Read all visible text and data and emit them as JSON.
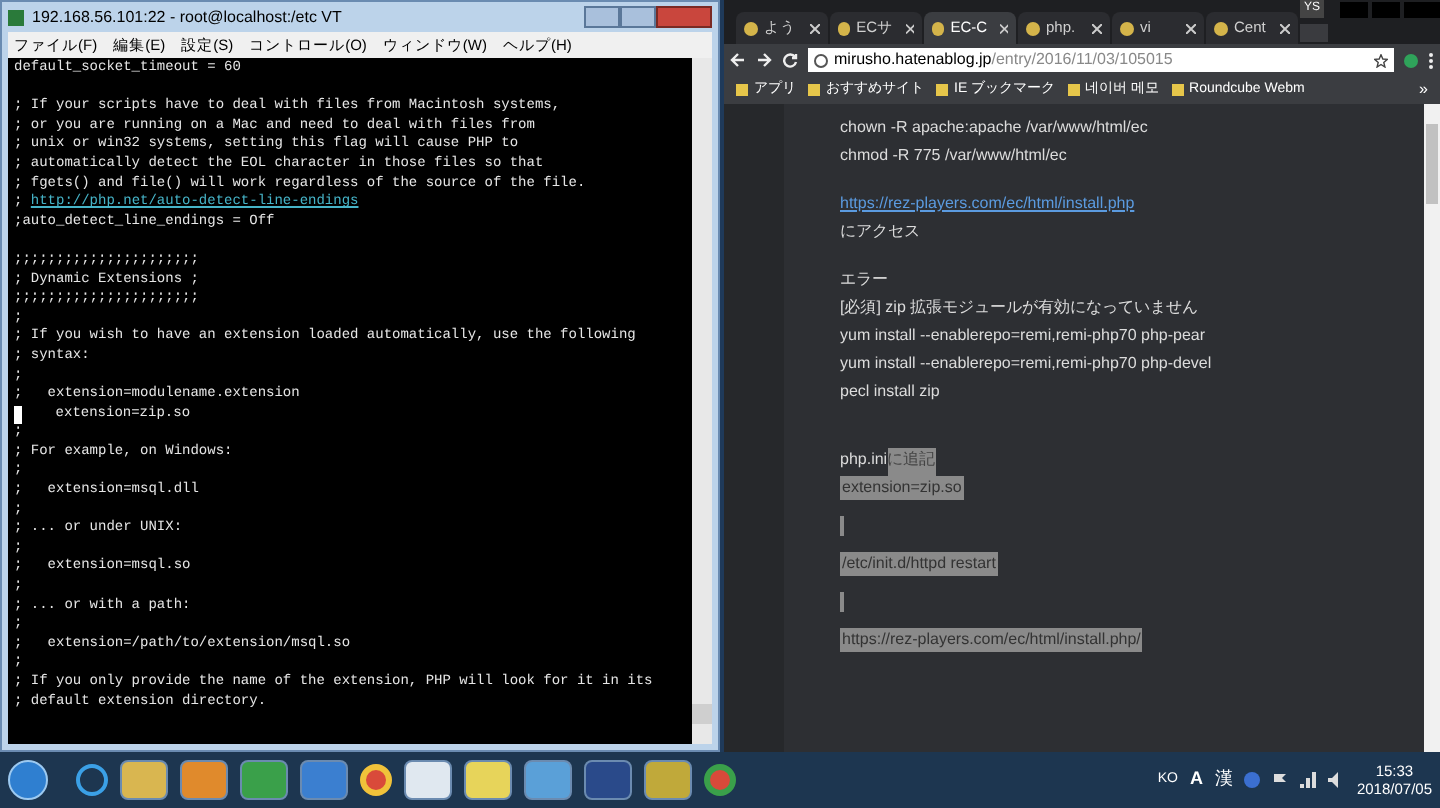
{
  "terminal": {
    "title": "192.168.56.101:22 - root@localhost:/etc VT",
    "menu": [
      "ファイル(F)",
      "編集(E)",
      "設定(S)",
      "コントロール(O)",
      "ウィンドウ(W)",
      "ヘルプ(H)"
    ],
    "lines": [
      {
        "kind": "text",
        "text": "default_socket_timeout = 60"
      },
      {
        "kind": "blank"
      },
      {
        "kind": "text",
        "text": "; If your scripts have to deal with files from Macintosh systems,"
      },
      {
        "kind": "text",
        "text": "; or you are running on a Mac and need to deal with files from"
      },
      {
        "kind": "text",
        "text": "; unix or win32 systems, setting this flag will cause PHP to"
      },
      {
        "kind": "text",
        "text": "; automatically detect the EOL character in those files so that"
      },
      {
        "kind": "text",
        "text": "; fgets() and file() will work regardless of the source of the file."
      },
      {
        "kind": "link",
        "prefix": "; ",
        "text": "http://php.net/auto-detect-line-endings"
      },
      {
        "kind": "text",
        "text": ";auto_detect_line_endings = Off"
      },
      {
        "kind": "blank"
      },
      {
        "kind": "text",
        "text": ";;;;;;;;;;;;;;;;;;;;;;"
      },
      {
        "kind": "text",
        "text": "; Dynamic Extensions ;"
      },
      {
        "kind": "text",
        "text": ";;;;;;;;;;;;;;;;;;;;;;"
      },
      {
        "kind": "text",
        "text": ";"
      },
      {
        "kind": "text",
        "text": "; If you wish to have an extension loaded automatically, use the following"
      },
      {
        "kind": "text",
        "text": "; syntax:"
      },
      {
        "kind": "text",
        "text": ";"
      },
      {
        "kind": "text",
        "text": ";   extension=modulename.extension"
      },
      {
        "kind": "cursor",
        "text": "    extension=zip.so"
      },
      {
        "kind": "text",
        "text": ";"
      },
      {
        "kind": "text",
        "text": "; For example, on Windows:"
      },
      {
        "kind": "text",
        "text": ";"
      },
      {
        "kind": "text",
        "text": ";   extension=msql.dll"
      },
      {
        "kind": "text",
        "text": ";"
      },
      {
        "kind": "text",
        "text": "; ... or under UNIX:"
      },
      {
        "kind": "text",
        "text": ";"
      },
      {
        "kind": "text",
        "text": ";   extension=msql.so"
      },
      {
        "kind": "text",
        "text": ";"
      },
      {
        "kind": "text",
        "text": "; ... or with a path:"
      },
      {
        "kind": "text",
        "text": ";"
      },
      {
        "kind": "text",
        "text": ";   extension=/path/to/extension/msql.so"
      },
      {
        "kind": "text",
        "text": ";"
      },
      {
        "kind": "text",
        "text": "; If you only provide the name of the extension, PHP will look for it in its"
      },
      {
        "kind": "text",
        "text": "; default extension directory."
      }
    ]
  },
  "browser": {
    "user": "YS",
    "tabs": [
      {
        "label": "よう",
        "selected": false
      },
      {
        "label": "ECサ",
        "selected": false
      },
      {
        "label": "EC-C",
        "selected": true
      },
      {
        "label": "php.",
        "selected": false
      },
      {
        "label": "vi",
        "selected": false
      },
      {
        "label": "Cent",
        "selected": false
      }
    ],
    "url_host": "mirusho.hatenablog.jp",
    "url_path": "/entry/2016/11/03/105015",
    "bookmarks": [
      "アプリ",
      "おすすめサイト",
      "IE ブックマーク",
      "네이버 메모",
      "Roundcube Webm"
    ],
    "bookmarks_more": "»",
    "article": [
      {
        "kind": "text",
        "text": "chown -R apache:apache /var/www/html/ec"
      },
      {
        "kind": "text",
        "text": "chmod -R 775 /var/www/html/ec"
      },
      {
        "kind": "gap"
      },
      {
        "kind": "link",
        "text": "https://rez-players.com/ec/html/install.php"
      },
      {
        "kind": "text",
        "text": "にアクセス"
      },
      {
        "kind": "gap"
      },
      {
        "kind": "text",
        "text": "エラー"
      },
      {
        "kind": "text",
        "text": "[必須] zip 拡張モジュールが有効になっていません"
      },
      {
        "kind": "text",
        "text": "yum install --enablerepo=remi,remi-php70 php-pear"
      },
      {
        "kind": "text",
        "text": "yum install --enablerepo=remi,remi-php70 php-devel"
      },
      {
        "kind": "text",
        "text": "pecl install zip"
      },
      {
        "kind": "gap"
      },
      {
        "kind": "gap"
      },
      {
        "kind": "mixed",
        "text": "php.ini",
        "highlight": "に追記"
      },
      {
        "kind": "highlight",
        "text": "extension=zip.so"
      },
      {
        "kind": "bar"
      },
      {
        "kind": "highlight",
        "text": "/etc/init.d/httpd restart"
      },
      {
        "kind": "bar"
      },
      {
        "kind": "highlight",
        "text": "https://rez-players.com/ec/html/install.php/"
      }
    ]
  },
  "taskbar": {
    "ime": "KO",
    "ime_mode": "A",
    "ime_kanji": "漢",
    "time": "15:33",
    "date": "2018/07/05"
  }
}
